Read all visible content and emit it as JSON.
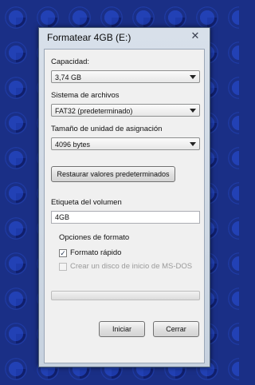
{
  "window": {
    "title": "Formatear 4GB (E:)",
    "close_glyph": "✕"
  },
  "capacity": {
    "label": "Capacidad:",
    "value": "3,74 GB"
  },
  "filesystem": {
    "label": "Sistema de archivos",
    "value": "FAT32 (predeterminado)"
  },
  "allocation": {
    "label": "Tamaño de unidad de asignación",
    "value": "4096 bytes"
  },
  "restore_button": "Restaurar valores predeterminados",
  "volume": {
    "label": "Etiqueta del volumen",
    "value": "4GB"
  },
  "format_options": {
    "label": "Opciones de formato",
    "quick_format": {
      "label": "Formato rápido",
      "checked": true
    },
    "msdos_disk": {
      "label": "Crear un disco de inicio de MS-DOS",
      "checked": false,
      "disabled": true
    }
  },
  "progress": {
    "value": 0
  },
  "buttons": {
    "start": "Iniciar",
    "close": "Cerrar"
  },
  "colors": {
    "background": "#1a2f86",
    "dialog_frame": "#c7d2df"
  }
}
